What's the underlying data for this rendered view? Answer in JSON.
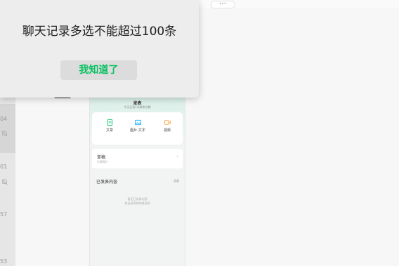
{
  "topbar": {
    "more_label": "•••"
  },
  "sidebar": {
    "times": [
      "04",
      "01",
      "57",
      "53"
    ]
  },
  "dialog": {
    "message": "聊天记录多选不能超过100条",
    "button_label": "我知道了",
    "button_color": "#07c160"
  },
  "phone": {
    "header_title": "发表",
    "header_subtitle": "今天还有1次群发次数",
    "actions": [
      {
        "label": "文章",
        "icon": "article-icon",
        "color": "#07c160"
      },
      {
        "label": "图片·文字",
        "icon": "image-icon",
        "color": "#10aeff"
      },
      {
        "label": "视频",
        "icon": "video-icon",
        "color": "#fa9d3b"
      }
    ],
    "draft": {
      "title": "草稿",
      "subtitle": "分享图片"
    },
    "published": {
      "title": "已发表内容",
      "all_label": "全部"
    },
    "empty": {
      "line1": "暂无已发表内容",
      "line2": "快去发表你的想法吧"
    }
  }
}
